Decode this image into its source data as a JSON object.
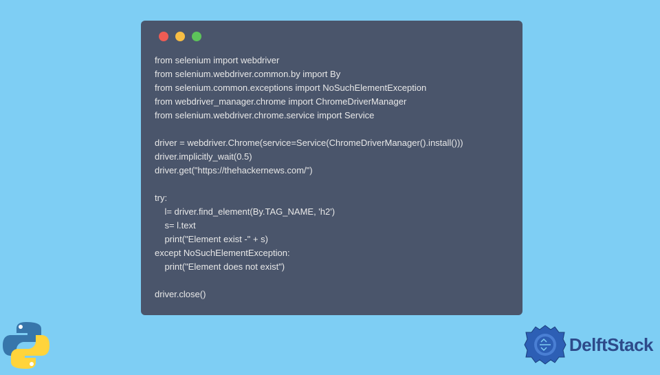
{
  "code": {
    "line1": "from selenium import webdriver",
    "line2": "from selenium.webdriver.common.by import By",
    "line3": "from selenium.common.exceptions import NoSuchElementException",
    "line4": "from webdriver_manager.chrome import ChromeDriverManager",
    "line5": "from selenium.webdriver.chrome.service import Service",
    "line6": "",
    "line7": "driver = webdriver.Chrome(service=Service(ChromeDriverManager().install()))",
    "line8": "driver.implicitly_wait(0.5)",
    "line9": "driver.get(\"https://thehackernews.com/\")",
    "line10": "",
    "line11": "try:",
    "line12": "    l= driver.find_element(By.TAG_NAME, 'h2')",
    "line13": "    s= l.text",
    "line14": "    print(\"Element exist -\" + s)",
    "line15": "except NoSuchElementException:",
    "line16": "    print(\"Element does not exist\")",
    "line17": "",
    "line18": "driver.close()"
  },
  "branding": {
    "name": "DelftStack"
  }
}
